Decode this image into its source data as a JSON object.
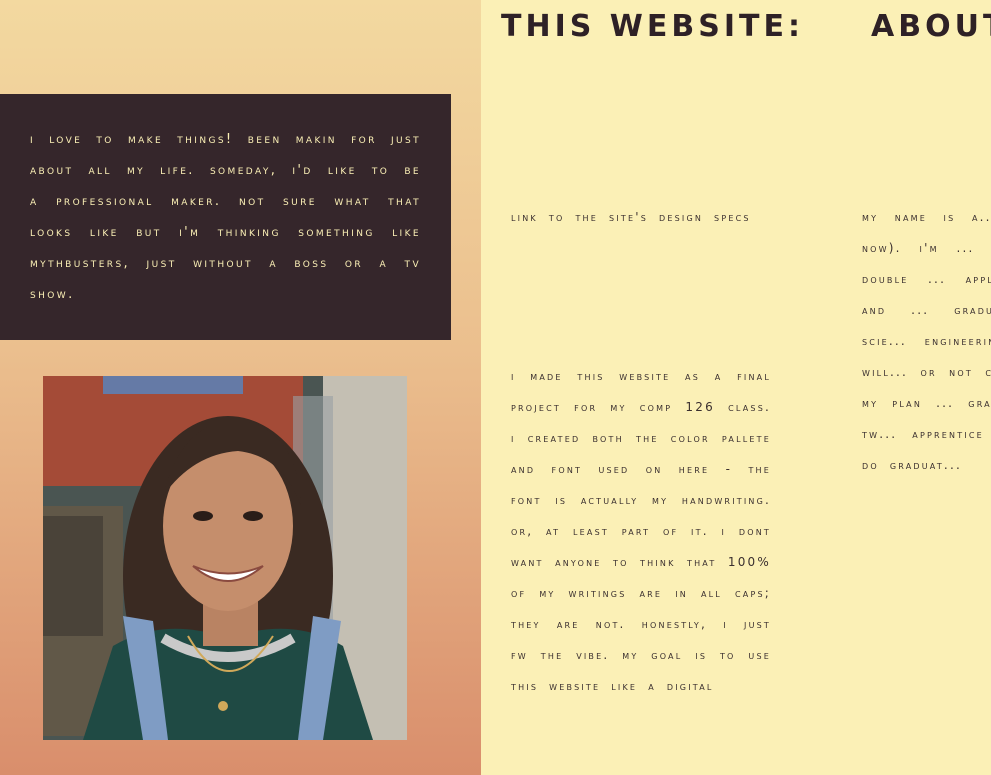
{
  "intro": {
    "text": "I love to make things! Been makin for just about all my life. Someday, I'd like to be a professional maker. Not sure what that looks like but I'm thinking something like Mythbusters, just without a boss or a TV show."
  },
  "photo": {
    "alt_icon": "portrait-photo"
  },
  "headings": {
    "this_website": "This Website:",
    "about": "About"
  },
  "this_website": {
    "link_text": "Link to the site's design specs",
    "description": "I made this website as a final project for my COMP 126 class. I created both the color pallete and font used on here - the font is actually my handwriting. Or, at least part of it. I dont want anyone to think that 100% of my writings are in all caps; they are not. Honestly, I just fw the vibe. My goal is to use this website like a digital"
  },
  "about": {
    "text": "My name is A... you probably... by now). I'm ... third year he... am double ... applied mathe... French, and ... graduate with... applied scie... engineering, th... sure if I will... or not con... doesn't offici... my plan ... graduate is ... year or tw... apprentice a... blowing studi... do graduat..."
  }
}
